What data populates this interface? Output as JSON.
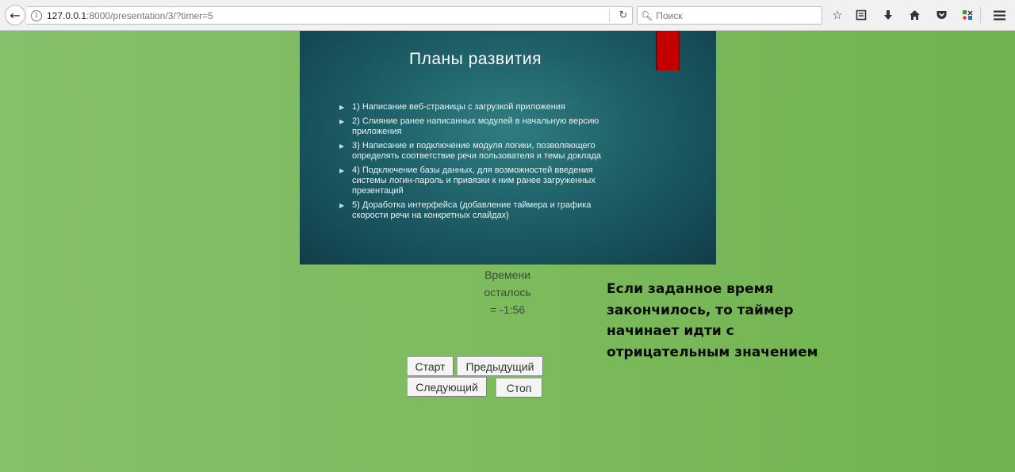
{
  "browser": {
    "url_host": "127.0.0.1",
    "url_rest": ":8000/presentation/3/?timer=5",
    "search_placeholder": "Поиск",
    "icons": [
      "back-arrow-icon",
      "info-icon",
      "reload-icon",
      "search-icon",
      "star-icon",
      "reading-list-icon",
      "download-icon",
      "home-icon",
      "pocket-icon",
      "extension-icon",
      "menu-icon"
    ]
  },
  "slide": {
    "title": "Планы развития",
    "items": [
      "1) Написание веб-страницы с загрузкой приложения",
      "2) Слияние ранее написанных модулей в начальную версию приложения",
      "3) Написание и подключение модуля логики, позволяющего определять соответствие речи пользователя и темы доклада",
      "4) Подключение базы данных, для возможностей введения системы логин-пароль и привязки к ним ранее загруженных презентаций",
      "5) Доработка интерфейса (добавление таймера и графика скорости речи на конкретных слайдах)"
    ]
  },
  "timer": {
    "line1": "Времени",
    "line2": "осталось",
    "line3": "= -1:56"
  },
  "note": {
    "line1": "Если заданное время",
    "line2": "закончилось, то таймер",
    "line3": "начинает идти с",
    "line4": "отрицательным значением"
  },
  "controls": {
    "start": "Старт",
    "previous": "Предыдущий",
    "next": "Следующий",
    "stop": "Стоп"
  },
  "colors": {
    "background": "#7dbb5d",
    "slide_bg": "#1e5f68",
    "ribbon": "#c40000"
  }
}
